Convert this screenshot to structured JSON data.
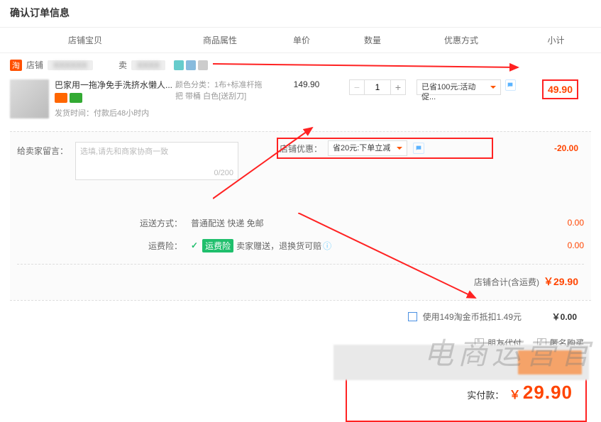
{
  "title": "确认订单信息",
  "headers": {
    "item": "店铺宝贝",
    "attr": "商品属性",
    "price": "单价",
    "qty": "数量",
    "promo": "优惠方式",
    "subtotal": "小计"
  },
  "shop": {
    "badge": "淘",
    "name_prefix": "店铺",
    "seller_prefix": "卖"
  },
  "item": {
    "title": "巴家用一拖净免手洗挤水懒人...",
    "attr": "颜色分类：1布+标准杆拖把 带桶 白色[送刮刀]",
    "ship_time": "发货时间：付款后48小时内",
    "unit_price": "149.90",
    "qty": "1",
    "promo_select": "已省100元:活动促...",
    "subtotal": "49.90"
  },
  "message": {
    "label": "给卖家留言：",
    "placeholder": "选填,请先和商家协商一致",
    "counter": "0/200"
  },
  "store_promo": {
    "label": "店铺优惠：",
    "select": "省20元:下单立减",
    "value": "-20.00"
  },
  "shipping": {
    "label": "运送方式：",
    "text": "普通配送 快递 免邮",
    "value": "0.00"
  },
  "insurance": {
    "label": "运费险：",
    "badge": "运费险",
    "text": "卖家赠送，退换货可赔",
    "value": "0.00"
  },
  "shop_total": {
    "label": "店铺合计(含运费)",
    "value": "￥29.90"
  },
  "coin": {
    "text": "使用149淘金币抵扣1.49元",
    "value": "￥0.00"
  },
  "options": {
    "friend_pay": "朋友代付",
    "anon": "匿名购买"
  },
  "grand": {
    "label": "实付款：",
    "currency": "￥",
    "value": "29.90"
  },
  "watermark": "电商运营官"
}
